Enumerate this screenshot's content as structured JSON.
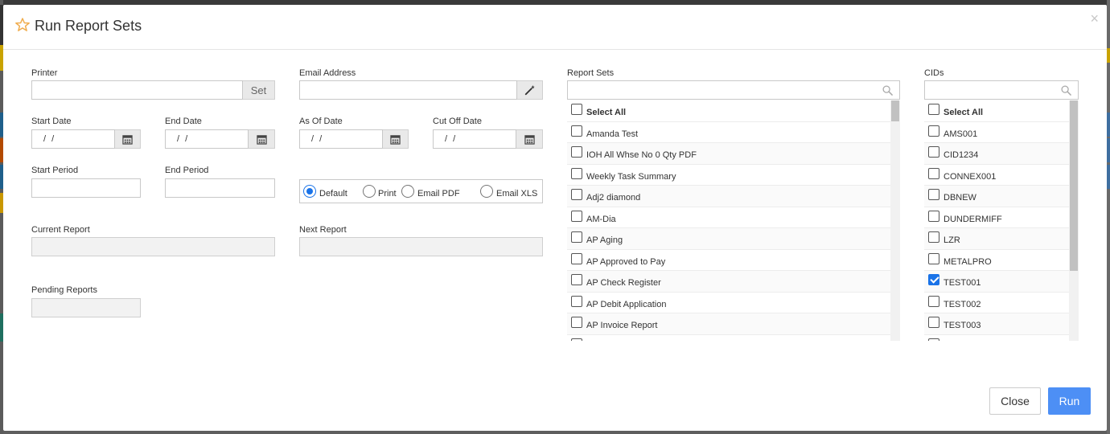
{
  "dialog": {
    "title": "Run Report Sets",
    "close_glyph": "×"
  },
  "form": {
    "printer": {
      "label": "Printer",
      "value": "",
      "set_label": "Set"
    },
    "email": {
      "label": "Email Address",
      "value": ""
    },
    "start_date": {
      "label": "Start Date",
      "value": "/ /"
    },
    "end_date": {
      "label": "End Date",
      "value": "/ /"
    },
    "as_of_date": {
      "label": "As Of Date",
      "value": "/ /"
    },
    "cut_off_date": {
      "label": "Cut Off Date",
      "value": "/ /"
    },
    "start_period": {
      "label": "Start Period",
      "value": ""
    },
    "end_period": {
      "label": "End Period",
      "value": ""
    },
    "output": {
      "options": [
        "Default",
        "Print",
        "Email PDF",
        "Email XLS"
      ],
      "selected": "Default"
    },
    "current_report": {
      "label": "Current Report",
      "value": ""
    },
    "next_report": {
      "label": "Next Report",
      "value": ""
    },
    "pending_reports": {
      "label": "Pending Reports",
      "value": ""
    }
  },
  "report_sets": {
    "label": "Report Sets",
    "search_value": "",
    "select_all": "Select All",
    "items": [
      {
        "label": "Amanda Test",
        "checked": false
      },
      {
        "label": "IOH All Whse No 0 Qty PDF",
        "checked": false
      },
      {
        "label": "Weekly Task Summary",
        "checked": false
      },
      {
        "label": "Adj2 diamond",
        "checked": false
      },
      {
        "label": "AM-Dia",
        "checked": false
      },
      {
        "label": "AP Aging",
        "checked": false
      },
      {
        "label": "AP Approved to Pay",
        "checked": false
      },
      {
        "label": "AP Check Register",
        "checked": false
      },
      {
        "label": "AP Debit Application",
        "checked": false
      },
      {
        "label": "AP Invoice Report",
        "checked": false
      }
    ]
  },
  "cids": {
    "label": "CIDs",
    "search_value": "",
    "select_all": "Select All",
    "items": [
      {
        "label": "AMS001",
        "checked": false
      },
      {
        "label": "CID1234",
        "checked": false
      },
      {
        "label": "CONNEX001",
        "checked": false
      },
      {
        "label": "DBNEW",
        "checked": false
      },
      {
        "label": "DUNDERMIFF",
        "checked": false
      },
      {
        "label": "LZR",
        "checked": false
      },
      {
        "label": "METALPRO",
        "checked": false
      },
      {
        "label": "TEST001",
        "checked": true
      },
      {
        "label": "TEST002",
        "checked": false
      },
      {
        "label": "TEST003",
        "checked": false
      }
    ]
  },
  "buttons": {
    "close": "Close",
    "run": "Run"
  },
  "colors": {
    "accent": "#1a73e8",
    "run_button": "#4d8ff5",
    "star": "#f0ad4e"
  }
}
